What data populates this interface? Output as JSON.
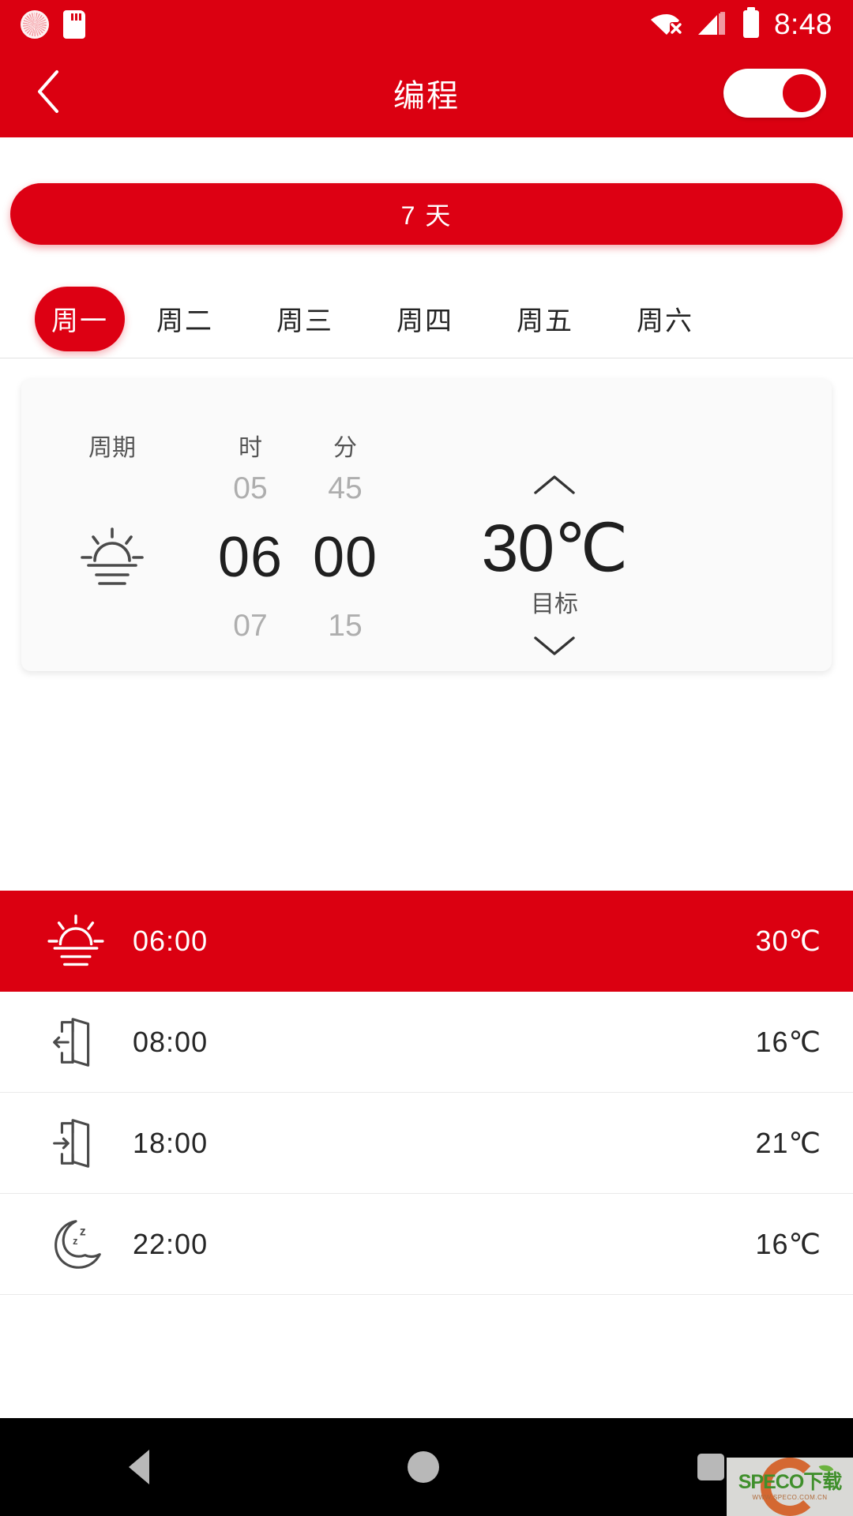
{
  "status_bar": {
    "time": "8:48",
    "icons": [
      "dial-icon",
      "sd-card-icon",
      "wifi-off-icon",
      "signal-icon",
      "battery-icon"
    ]
  },
  "app_bar": {
    "back_icon": "chevron-left-icon",
    "title": "编程",
    "toggle_state": "on"
  },
  "mode_button": {
    "label": "7 天"
  },
  "day_tabs": {
    "selected_index": 0,
    "items": [
      {
        "label": "周一"
      },
      {
        "label": "周二"
      },
      {
        "label": "周三"
      },
      {
        "label": "周四"
      },
      {
        "label": "周五"
      },
      {
        "label": "周六"
      }
    ]
  },
  "picker_card": {
    "headers": {
      "cycle": "周期",
      "hour": "时",
      "minute": "分"
    },
    "cycle": {
      "icon": "sunrise-icon",
      "selected": "sunrise"
    },
    "hour": {
      "previous": "05",
      "selected": "06",
      "next": "07"
    },
    "minute": {
      "previous": "45",
      "selected": "00",
      "next": "15"
    },
    "temperature": {
      "up_icon": "chevron-up-icon",
      "value": "30℃",
      "label": "目标",
      "down_icon": "chevron-down-icon"
    }
  },
  "schedule": {
    "rows": [
      {
        "icon": "sunrise-icon",
        "time": "06:00",
        "temp": "30℃",
        "active": true
      },
      {
        "icon": "leave-home-icon",
        "time": "08:00",
        "temp": "16℃",
        "active": false
      },
      {
        "icon": "return-home-icon",
        "time": "18:00",
        "temp": "21℃",
        "active": false
      },
      {
        "icon": "sleep-moon-icon",
        "time": "22:00",
        "temp": "16℃",
        "active": false
      }
    ]
  },
  "nav_bar": {
    "back": "back-triangle-icon",
    "home": "home-circle-icon",
    "recents": "recents-square-icon"
  },
  "watermark": {
    "main": "SPECO下载",
    "sub": "WWW.SPECO.COM.CN"
  },
  "colors": {
    "brand_red": "#DB0011",
    "accent_red": "#DD0013",
    "card_bg": "#FAFAFA",
    "text_dark": "#1f1f1f",
    "text_muted": "#AEAEAE"
  }
}
